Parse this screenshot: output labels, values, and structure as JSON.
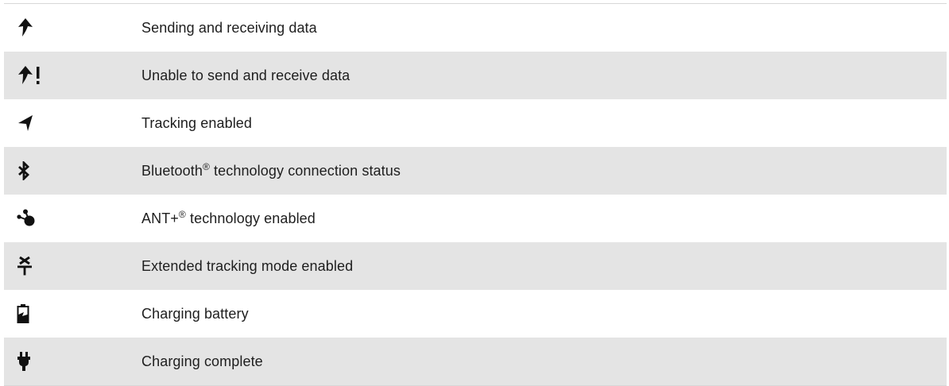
{
  "rows": [
    {
      "icon": "sending-receiving-icon",
      "text": "Sending and receiving data"
    },
    {
      "icon": "unable-send-receive-icon",
      "text": "Unable to send and receive data"
    },
    {
      "icon": "tracking-icon",
      "text": "Tracking enabled"
    },
    {
      "icon": "bluetooth-icon",
      "pre": "Bluetooth",
      "sup": "®",
      "post": " technology connection status"
    },
    {
      "icon": "ant-plus-icon",
      "pre": "ANT+",
      "sup": "®",
      "post": " technology enabled"
    },
    {
      "icon": "extended-tracking-icon",
      "text": "Extended tracking mode enabled"
    },
    {
      "icon": "charging-battery-icon",
      "text": "Charging battery"
    },
    {
      "icon": "charging-complete-icon",
      "text": "Charging complete"
    }
  ]
}
